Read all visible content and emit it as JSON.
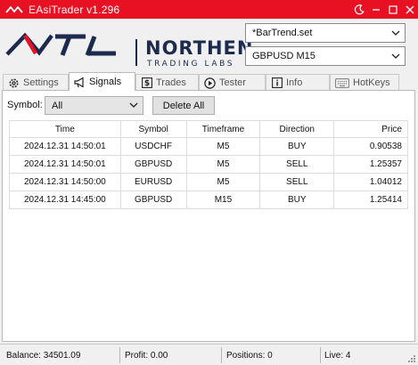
{
  "window": {
    "title": "EAsiTrader v1.296",
    "accent": "#e81123"
  },
  "brand": {
    "name": "NORTHEN",
    "tagline": "TRADING LABS"
  },
  "selectors": {
    "settings_file": "*BarTrend.set",
    "symbol_timeframe": "GBPUSD M15"
  },
  "tabs": [
    {
      "label": "Settings",
      "icon": "gear-icon"
    },
    {
      "label": "Signals",
      "icon": "megaphone-icon"
    },
    {
      "label": "Trades",
      "icon": "dollar-icon"
    },
    {
      "label": "Tester",
      "icon": "play-icon"
    },
    {
      "label": "Info",
      "icon": "info-icon"
    },
    {
      "label": "HotKeys",
      "icon": "keyboard-icon"
    }
  ],
  "active_tab": "Signals",
  "signals": {
    "symbol_label": "Symbol:",
    "symbol_filter": "All",
    "delete_all_label": "Delete All",
    "columns": [
      "Time",
      "Symbol",
      "Timeframe",
      "Direction",
      "Price"
    ],
    "rows": [
      [
        "2024.12.31 14:50:01",
        "USDCHF",
        "M5",
        "BUY",
        "0.90538"
      ],
      [
        "2024.12.31 14:50:01",
        "GBPUSD",
        "M5",
        "SELL",
        "1.25357"
      ],
      [
        "2024.12.31 14:50:00",
        "EURUSD",
        "M5",
        "SELL",
        "1.04012"
      ],
      [
        "2024.12.31 14:45:00",
        "GBPUSD",
        "M15",
        "BUY",
        "1.25414"
      ]
    ]
  },
  "status": {
    "balance": "Balance: 34501.09",
    "profit": "Profit: 0.00",
    "positions": "Positions: 0",
    "live": "Live: 4"
  }
}
